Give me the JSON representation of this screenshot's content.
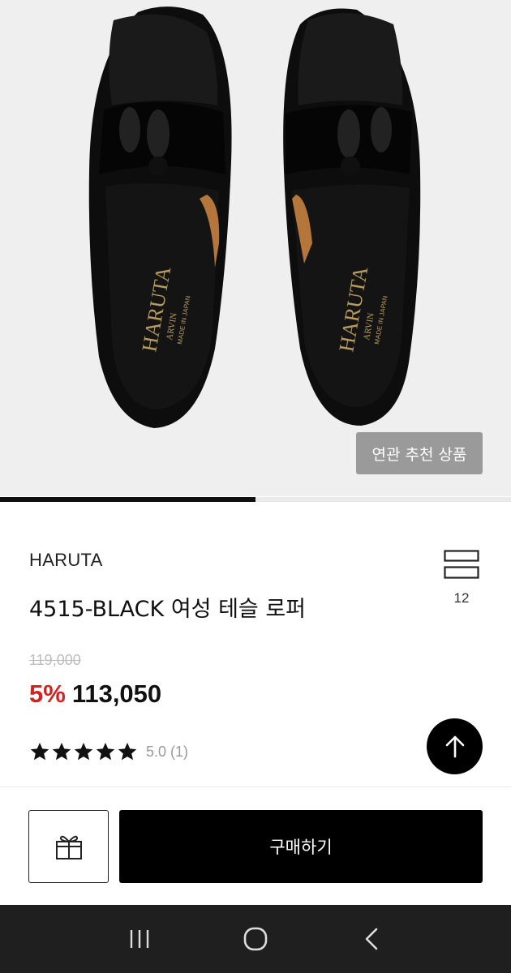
{
  "hero": {
    "image_alt": "black tassel loafers",
    "related_button_label": "연관 추천 상품",
    "carousel_progress": 0.5
  },
  "product": {
    "brand": "HARUTA",
    "title": "4515-BLACK 여성 테슬 로퍼",
    "like_count": "12",
    "original_price": "119,000",
    "discount": "5%",
    "price": "113,050",
    "rating_text": "5.0 (1)",
    "rating_stars": 5
  },
  "actions": {
    "gift_icon": "gift-icon",
    "buy_label": "구매하기",
    "scroll_top_icon": "arrow-up-icon"
  },
  "navbar": {
    "recent_icon": "recent-apps-icon",
    "home_icon": "home-icon",
    "back_icon": "back-icon"
  },
  "colors": {
    "discount": "#d32222",
    "primary": "#000000",
    "related_button_bg": "#9a9a9a"
  }
}
